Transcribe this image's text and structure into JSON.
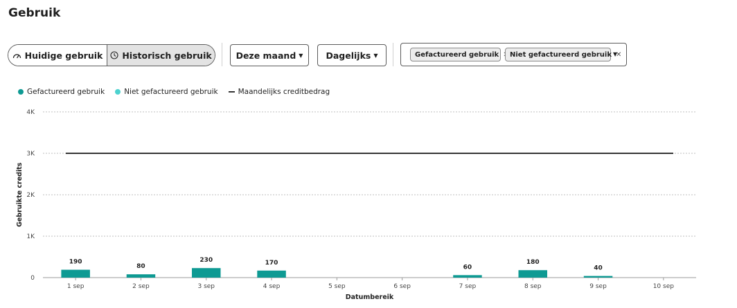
{
  "page": {
    "title": "Gebruik"
  },
  "toggle": {
    "current_label": "Huidige gebruik",
    "historic_label": "Historisch gebruik",
    "selected": "historic"
  },
  "filters": {
    "period_label": "Deze maand",
    "granularity_label": "Dagelijks",
    "chips": [
      {
        "label": "Gefactureerd gebruik"
      },
      {
        "label": "Niet gefactureerd gebruik"
      }
    ]
  },
  "icons": {
    "current": "gauge-icon",
    "historic": "clock-icon",
    "dropdown": "caret-down-icon",
    "chip_remove": "close-icon"
  },
  "colors": {
    "billed": "#0e9a93",
    "unbilled": "#4dd2cf",
    "limit": "#333333",
    "grid": "#bdbdbd",
    "selected_toggle": "#e3e3e3"
  },
  "chart_data": {
    "type": "bar",
    "xlabel": "Datumbereik",
    "ylabel": "Gebruikte credits",
    "ylim": [
      0,
      4000
    ],
    "yticks": [
      0,
      1000,
      2000,
      3000,
      4000
    ],
    "ytick_labels": [
      "0",
      "1K",
      "2K",
      "3K",
      "4K"
    ],
    "categories": [
      "1 sep",
      "2 sep",
      "3 sep",
      "4 sep",
      "5 sep",
      "6 sep",
      "7 sep",
      "8 sep",
      "9 sep",
      "10 sep"
    ],
    "series": [
      {
        "name": "Gefactureerd gebruik",
        "values": [
          190,
          80,
          230,
          170,
          0,
          0,
          60,
          180,
          40,
          0
        ]
      },
      {
        "name": "Niet gefactureerd gebruik",
        "values": [
          0,
          0,
          0,
          0,
          0,
          0,
          0,
          0,
          0,
          0
        ]
      }
    ],
    "data_labels": [
      "190",
      "80",
      "230",
      "170",
      "",
      "",
      "60",
      "180",
      "40",
      ""
    ],
    "reference_line": {
      "name": "Maandelijks creditbedrag",
      "value": 3000
    },
    "grid": true,
    "legend_position": "top-left"
  }
}
